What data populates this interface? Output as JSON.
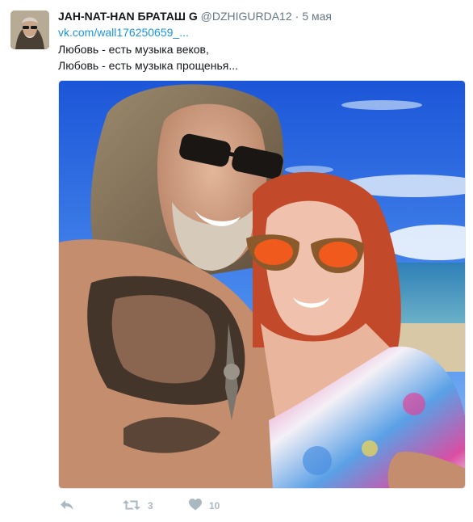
{
  "tweet": {
    "fullname": "JAH-NAT-HAN БРАТАШ G",
    "handle": "@DZHIGURDA12",
    "separator": "·",
    "time": "5 мая",
    "link": "vk.com/wall176250659_...",
    "text_lines": [
      "Любовь - есть музыка веков,",
      "Любовь - есть музыка прощенья..."
    ]
  },
  "actions": {
    "reply_icon": "reply-icon",
    "retweet_icon": "retweet-icon",
    "retweet_count": "3",
    "like_icon": "heart-icon",
    "like_count": "10"
  },
  "colors": {
    "link": "#1b95e0",
    "muted": "#657786",
    "action": "#aab8c2"
  }
}
